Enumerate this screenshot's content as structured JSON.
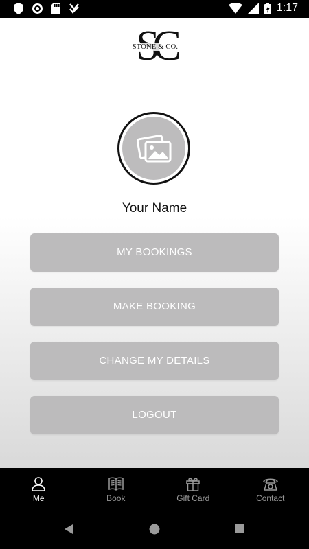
{
  "status_bar": {
    "time": "1:17",
    "icons": [
      "shield-icon",
      "sync-icon",
      "sd-card-icon",
      "download-check-icon",
      "wifi-icon",
      "signal-icon",
      "battery-icon"
    ]
  },
  "logo": {
    "monogram": "SC",
    "text": "STONE & CO."
  },
  "profile": {
    "name": "Your Name",
    "avatar_icon": "image-placeholder-icon"
  },
  "menu": {
    "my_bookings": "MY BOOKINGS",
    "make_booking": "MAKE BOOKING",
    "change_details": "CHANGE MY DETAILS",
    "logout": "LOGOUT"
  },
  "bottom_nav": {
    "active": "Me",
    "items": [
      {
        "label": "Me",
        "icon": "user-icon"
      },
      {
        "label": "Book",
        "icon": "book-icon"
      },
      {
        "label": "Gift Card",
        "icon": "gift-icon"
      },
      {
        "label": "Contact",
        "icon": "phone-icon"
      }
    ]
  },
  "colors": {
    "button_bg": "#bcbbbc",
    "button_text": "#ffffff",
    "nav_bg": "#000000",
    "nav_inactive": "#9a9a9a"
  }
}
